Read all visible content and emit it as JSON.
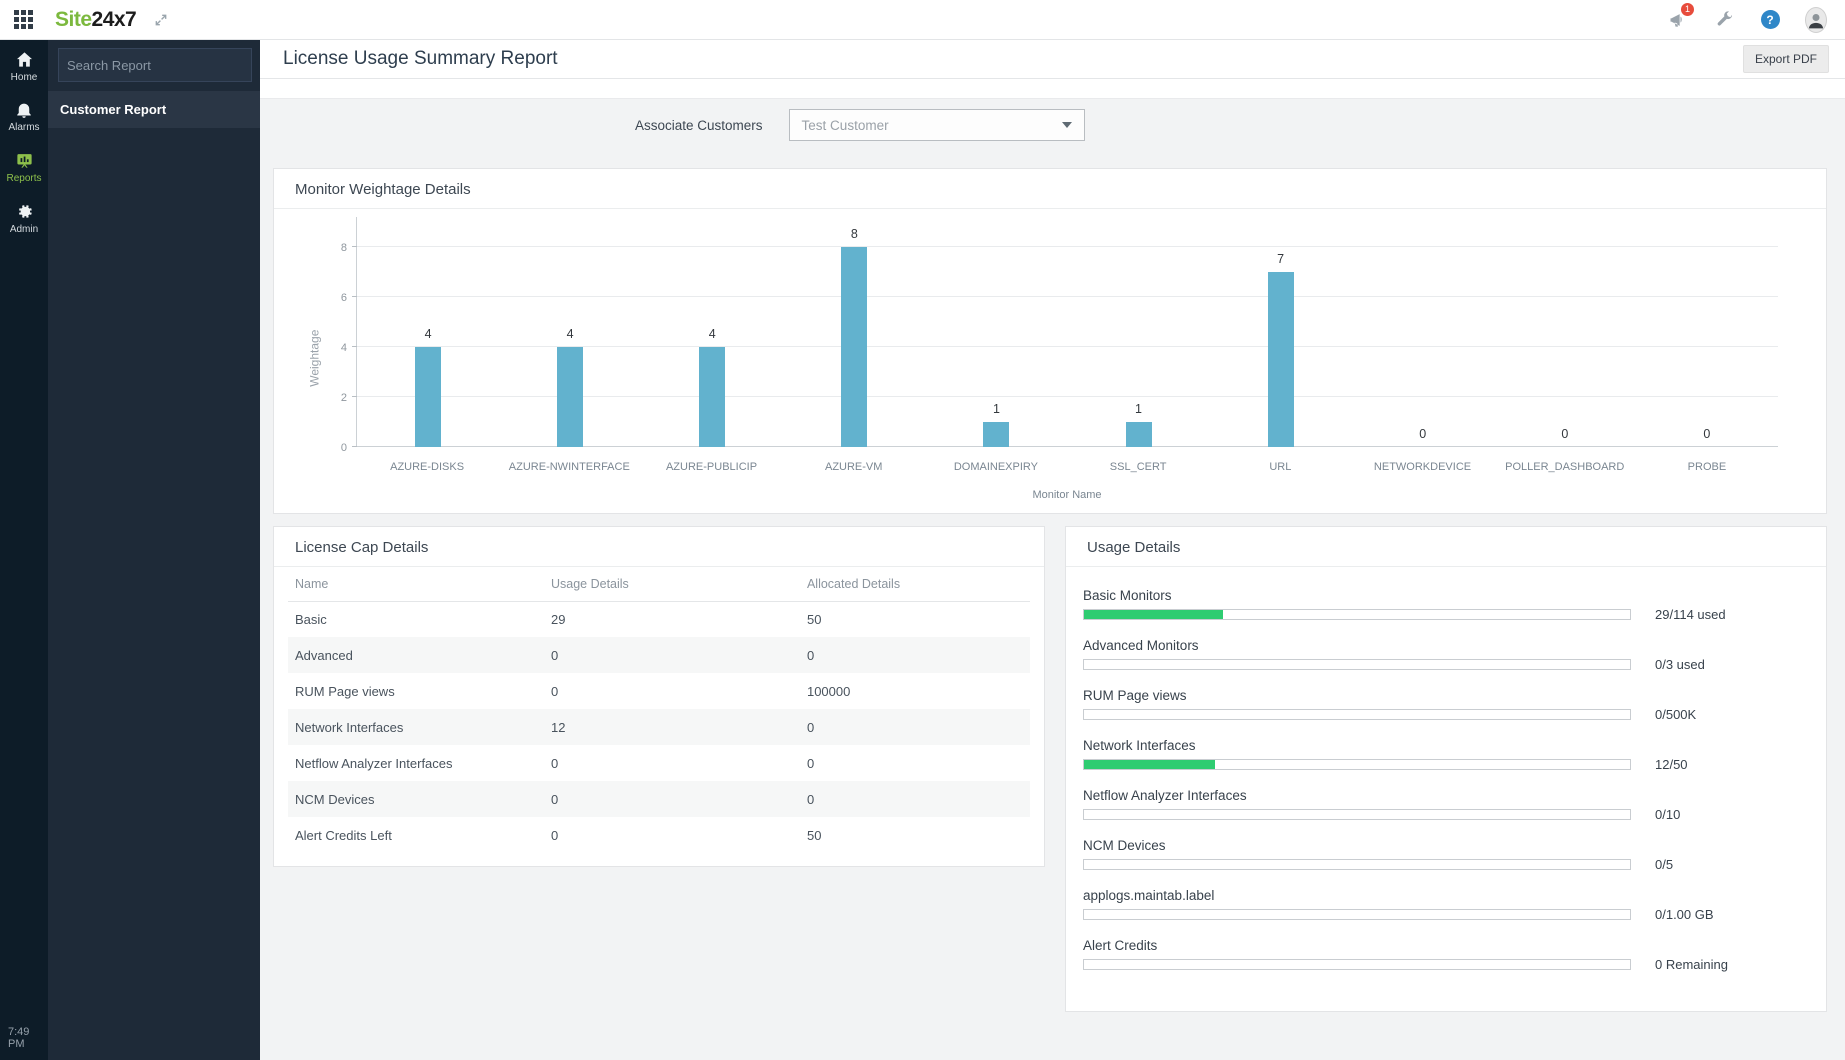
{
  "topbar": {
    "logo_green": "Site",
    "logo_dark": "24x7",
    "notification_count": "1",
    "help_glyph": "?"
  },
  "sidebar": {
    "nav": [
      {
        "label": "Home"
      },
      {
        "label": "Alarms"
      },
      {
        "label": "Reports",
        "active": true
      },
      {
        "label": "Admin"
      }
    ],
    "search_placeholder": "Search Report",
    "report_item": "Customer Report",
    "time": "7:49 PM"
  },
  "header": {
    "title": "License Usage Summary Report",
    "export_label": "Export PDF"
  },
  "filter": {
    "label": "Associate Customers",
    "selected_value": "Test Customer"
  },
  "chart_data": {
    "type": "bar",
    "title": "Monitor Weightage Details",
    "categories": [
      "AZURE-DISKS",
      "AZURE-NWINTERFACE",
      "AZURE-PUBLICIP",
      "AZURE-VM",
      "DOMAINEXPIRY",
      "SSL_CERT",
      "URL",
      "NETWORKDEVICE",
      "POLLER_DASHBOARD",
      "PROBE"
    ],
    "values": [
      4,
      4,
      4,
      8,
      1,
      1,
      7,
      0,
      0,
      0
    ],
    "xlabel": "Monitor Name",
    "ylabel": "Weightage",
    "ylim": [
      0,
      8
    ],
    "yticks": [
      0,
      2,
      4,
      6,
      8
    ],
    "grid": true,
    "legend": false,
    "bar_color": "#62b2ce"
  },
  "license_table": {
    "title": "License Cap Details",
    "columns": [
      "Name",
      "Usage Details",
      "Allocated Details"
    ],
    "rows": [
      [
        "Basic",
        "29",
        "50"
      ],
      [
        "Advanced",
        "0",
        "0"
      ],
      [
        "RUM Page views",
        "0",
        "100000"
      ],
      [
        "Network Interfaces",
        "12",
        "0"
      ],
      [
        "Netflow Analyzer Interfaces",
        "0",
        "0"
      ],
      [
        "NCM Devices",
        "0",
        "0"
      ],
      [
        "Alert Credits Left",
        "0",
        "50"
      ]
    ]
  },
  "usage": {
    "title": "Usage Details",
    "bar_color": "#2ecc71",
    "items": [
      {
        "label": "Basic Monitors",
        "value": "29/114 used",
        "percent": 25.4
      },
      {
        "label": "Advanced Monitors",
        "value": "0/3 used",
        "percent": 0
      },
      {
        "label": "RUM Page views",
        "value": "0/500K",
        "percent": 0
      },
      {
        "label": "Network Interfaces",
        "value": "12/50",
        "percent": 24
      },
      {
        "label": "Netflow Analyzer Interfaces",
        "value": "0/10",
        "percent": 0
      },
      {
        "label": "NCM Devices",
        "value": "0/5",
        "percent": 0
      },
      {
        "label": "applogs.maintab.label",
        "value": "0/1.00 GB",
        "percent": 0
      },
      {
        "label": "Alert Credits",
        "value": "0 Remaining",
        "percent": 0
      }
    ]
  },
  "colors": {
    "accent_green": "#7cb93e",
    "bar_blue": "#62b2ce",
    "progress_green": "#2ecc71",
    "sidebar_rail": "#0d1c28",
    "sidebar_panel": "#1e2a38",
    "badge_red": "#e74c3c",
    "help_blue": "#2f87c8"
  }
}
